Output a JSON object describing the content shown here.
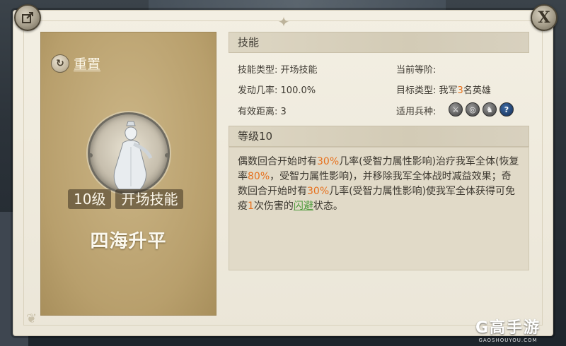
{
  "header": {
    "share_icon": "share-icon",
    "close_label": "X"
  },
  "skill_card": {
    "reset_label": "重置",
    "level_tag": "10级",
    "type_tag": "开场技能",
    "skill_name": "四海升平"
  },
  "skill_section": {
    "title": "技能",
    "type_label": "技能类型:",
    "type_value": "开场技能",
    "rank_label": "当前等阶:",
    "rank_value": "",
    "rate_label": "发动几率:",
    "rate_value": "100.0%",
    "target_label": "目标类型:",
    "target_prefix": "我军",
    "target_count": "3",
    "target_suffix": "名英雄",
    "range_label": "有效距离:",
    "range_value": "3",
    "arms_label": "适用兵种:",
    "arms": [
      {
        "icon": "sword-icon",
        "glyph": "⚔"
      },
      {
        "icon": "bow-target-icon",
        "glyph": "◎"
      },
      {
        "icon": "horse-icon",
        "glyph": "♞"
      },
      {
        "icon": "question-icon",
        "glyph": "?"
      }
    ]
  },
  "level_section": {
    "title": "等级10",
    "desc": {
      "p1": "偶数回合开始时有",
      "v1": "30%",
      "p2": "几率(受智力属性影响)治疗我军全体(恢复率",
      "v2": "80%",
      "p3": "，受智力属性影响)，并移除我军全体战时减益效果；奇数回合开始时有",
      "v3": "30%",
      "p4": "几率(受智力属性影响)使我军全体获得可免疫",
      "v4": "1",
      "p5": "次伤害的",
      "link": "闪避",
      "p6": "状态。"
    }
  },
  "watermark": {
    "logo": "G高手游",
    "sub": "GAOSHOUYOU.COM"
  },
  "colors": {
    "highlight": "#e6701c",
    "link": "#4e9b3c",
    "card": "#b89f6c",
    "panel": "#f3efe3"
  }
}
